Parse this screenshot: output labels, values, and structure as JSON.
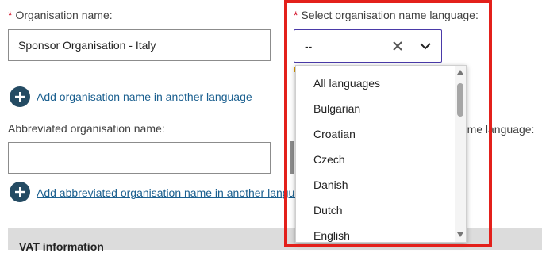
{
  "org_name": {
    "required_mark": "*",
    "label": "Organisation name:",
    "value": "Sponsor Organisation - Italy"
  },
  "add_org_name_link": "Add organisation name in another language",
  "language_select": {
    "required_mark": "*",
    "label": "Select organisation name language:",
    "value": "--",
    "options": [
      "All languages",
      "Bulgarian",
      "Croatian",
      "Czech",
      "Danish",
      "Dutch",
      "English"
    ]
  },
  "abbr_name": {
    "label": "Abbreviated organisation name:",
    "value": ""
  },
  "abbr_language_label_partial": "name language:",
  "add_abbr_name_link": "Add abbreviated organisation name in another language",
  "vat_section_title": "VAT information",
  "colors": {
    "highlight": "#e3201b",
    "link": "#1a5f8f",
    "plus_button": "#244b63",
    "select_border": "#4a3aa8"
  }
}
